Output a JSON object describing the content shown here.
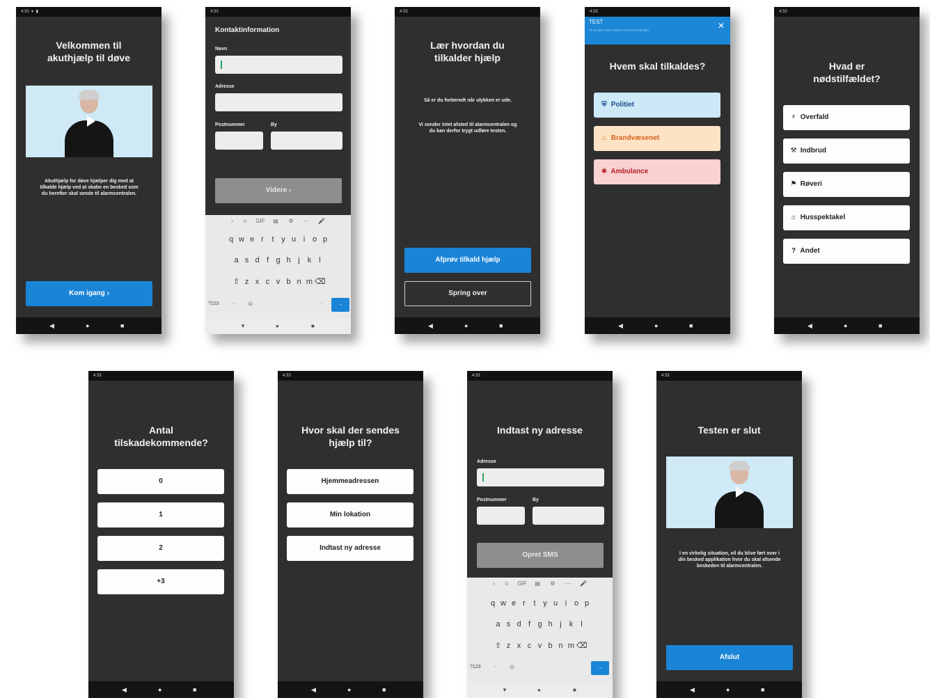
{
  "status_bar": {
    "time": "4:33",
    "left_icons": "◯ ◑ ▲ ▯ •",
    "right_icons": "▾ ▮"
  },
  "nav_bar": {
    "back": "◀",
    "home": "●",
    "recents": "■"
  },
  "screens": {
    "welcome": {
      "title": "Velkommen til akuthjælp til døve",
      "body": "Akuthjælp for døve hjælper dig med at tilkalde hjælp ved at skabe en besked som du herefter skal sende til alarmcentralen.",
      "button": "Kom igang  ›"
    },
    "contact": {
      "title": "Kontaktinformation",
      "name_label": "Navn",
      "address_label": "Adresse",
      "postal_label": "Postnummer",
      "city_label": "By",
      "button": "Videre  ›"
    },
    "learn": {
      "title": "Lær hvordan du tilkalder hjælp",
      "body1": "Så er du forberedt når ulykken er ude.",
      "body2": "Vi sender intet afsted til alarmcentralen og du kan derfor trygt udføre testen.",
      "primary_button": "Afprøv tilkald hjælp",
      "secondary_button": "Spring over"
    },
    "who": {
      "test_label": "TEST",
      "test_sub": "Vi sender intet afsted til alarmcentralen",
      "close": "✕",
      "title": "Hvem skal tilkaldes?",
      "options": [
        {
          "label": "Politiet",
          "icon": "shield-icon",
          "glyph": "⛨",
          "color": "#cde8f7",
          "text_color": "#1d4f8a"
        },
        {
          "label": "Brandvæsenet",
          "icon": "flame-icon",
          "glyph": "♨",
          "color": "#fde3c4",
          "text_color": "#d2641a"
        },
        {
          "label": "Ambulance",
          "icon": "star-of-life-icon",
          "glyph": "✱",
          "color": "#fbd0d0",
          "text_color": "#b0232a"
        }
      ]
    },
    "what": {
      "title": "Hvad er nødstilfældet?",
      "options": [
        {
          "label": "Overfald",
          "icon": "assault-icon",
          "glyph": "⚡"
        },
        {
          "label": "Indbrud",
          "icon": "burglary-icon",
          "glyph": "⚒"
        },
        {
          "label": "Røveri",
          "icon": "robbery-icon",
          "glyph": "⚑"
        },
        {
          "label": "Husspektakel",
          "icon": "domestic-dispute-icon",
          "glyph": "⌂"
        },
        {
          "label": "Andet",
          "icon": "question-icon",
          "glyph": "?"
        }
      ]
    },
    "count": {
      "title": "Antal tilskadekommende?",
      "options": [
        "0",
        "1",
        "2",
        "+3"
      ]
    },
    "where": {
      "title": "Hvor skal der sendes hjælp til?",
      "options": [
        "Hjemmeadressen",
        "Min lokation",
        "Indtast ny adresse"
      ]
    },
    "new_address": {
      "title": "Indtast ny adresse",
      "address_label": "Adresse",
      "postal_label": "Postnummer",
      "city_label": "By",
      "button": "Opret SMS"
    },
    "end": {
      "title": "Testen er slut",
      "body": "I en virkelig situation, vil du blive ført over i din besked applikation hvor du skal afsende beskeden til alarmcentralen.",
      "button": "Afslut"
    }
  },
  "keyboard": {
    "tools": [
      "›",
      "☺",
      "GIF",
      "▤",
      "⚙",
      "⋯",
      "🎤"
    ],
    "row1": [
      "q",
      "w",
      "e",
      "r",
      "t",
      "y",
      "u",
      "i",
      "o",
      "p"
    ],
    "row2": [
      "a",
      "s",
      "d",
      "f",
      "g",
      "h",
      "j",
      "k",
      "l"
    ],
    "row3": [
      "⇧",
      "z",
      "x",
      "c",
      "v",
      "b",
      "n",
      "m",
      "⌫"
    ],
    "row4_left": "?123",
    "row4_comma": ",",
    "row4_emoji": "☺",
    "row4_period": ".",
    "row4_enter": "→",
    "nav": [
      "▼",
      "●",
      "■"
    ]
  }
}
